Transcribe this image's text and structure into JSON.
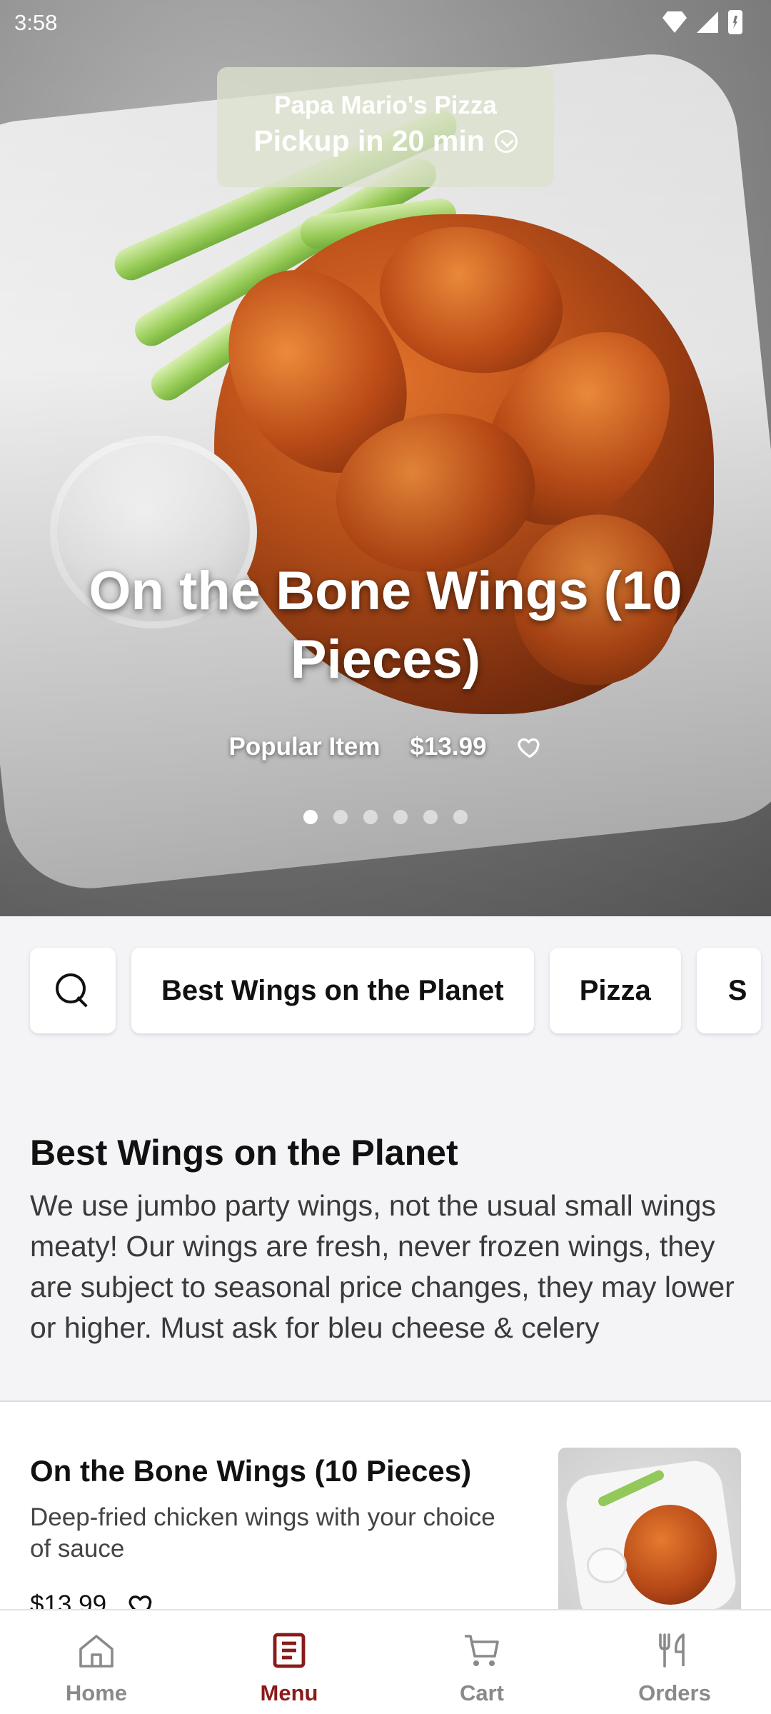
{
  "status_bar": {
    "time": "3:58"
  },
  "store": {
    "name": "Papa Mario's Pizza",
    "pickup": "Pickup in 20 min"
  },
  "hero": {
    "title": "On the Bone Wings (10 Pieces)",
    "badge": "Popular Item",
    "price": "$13.99",
    "slide_count": 6,
    "active_slide": 1
  },
  "categories": {
    "chips": [
      "Best Wings on the Planet",
      "Pizza",
      "S"
    ]
  },
  "section": {
    "title": "Best Wings on the Planet",
    "description": "We use jumbo party wings, not the usual small wings meaty! Our wings are fresh, never frozen wings, they are subject to seasonal price changes, they may lower or higher. Must ask for bleu cheese & celery"
  },
  "items": [
    {
      "name": "On the Bone Wings (10 Pieces)",
      "description": "Deep-fried chicken wings with your choice of sauce",
      "price": "$13.99"
    }
  ],
  "bottom_nav": {
    "items": [
      {
        "label": "Home",
        "icon": "home-icon"
      },
      {
        "label": "Menu",
        "icon": "menu-icon"
      },
      {
        "label": "Cart",
        "icon": "cart-icon"
      },
      {
        "label": "Orders",
        "icon": "utensils-icon"
      }
    ],
    "active": "Menu",
    "active_color": "#8b1a1a",
    "inactive_color": "#8a8a8a"
  }
}
